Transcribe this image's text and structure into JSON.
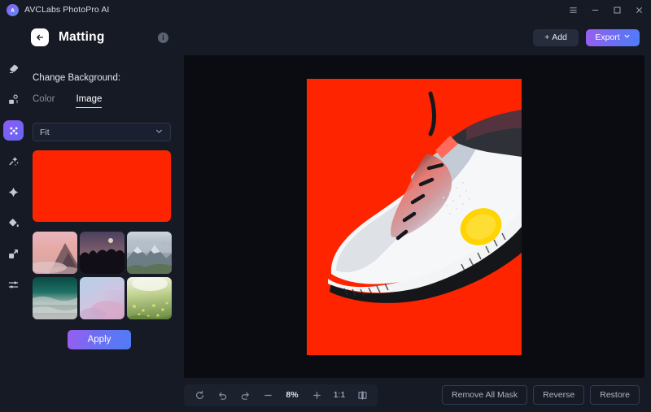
{
  "titlebar": {
    "app_name": "AVCLabs PhotoPro AI",
    "logo_icon": "ai-logo-icon",
    "controls": [
      {
        "name": "menu-icon",
        "label": "Menu"
      },
      {
        "name": "minimize-icon",
        "label": "Minimize"
      },
      {
        "name": "maximize-icon",
        "label": "Maximize"
      },
      {
        "name": "close-icon",
        "label": "Close"
      }
    ]
  },
  "rail": {
    "items": [
      {
        "name": "eraser-icon",
        "label": "Erase",
        "active": false
      },
      {
        "name": "object-remove-icon",
        "label": "Object Remove",
        "active": false
      },
      {
        "name": "matting-icon",
        "label": "Matting",
        "active": true
      },
      {
        "name": "magic-wand-icon",
        "label": "Magic Wand",
        "active": false
      },
      {
        "name": "enhance-icon",
        "label": "Enhance",
        "active": false
      },
      {
        "name": "paint-bucket-icon",
        "label": "Paint Bucket",
        "active": false
      },
      {
        "name": "resize-icon",
        "label": "Resize",
        "active": false
      },
      {
        "name": "adjust-sliders-icon",
        "label": "Adjust",
        "active": false
      }
    ]
  },
  "panel": {
    "back_icon": "back-arrow-icon",
    "title": "Matting",
    "info_icon": "info-icon",
    "section_label": "Change Background:",
    "tabs": [
      {
        "label": "Color",
        "active": false
      },
      {
        "label": "Image",
        "active": true
      }
    ],
    "fit_select": {
      "value": "Fit",
      "chevron_icon": "chevron-down-icon"
    },
    "preview_color": "#FF2400",
    "thumbnails": [
      {
        "name": "thumb-sunset-mountain",
        "alt": "Sunset mountain peak",
        "c1": "#f0bcc0",
        "c2": "#d79a9b",
        "c3": "#6f5057"
      },
      {
        "name": "thumb-night-treeline",
        "alt": "Night treeline with moon",
        "c1": "#5e4a63",
        "c2": "#8c6a73",
        "c3": "#14101a"
      },
      {
        "name": "thumb-snowy-mountains",
        "alt": "Snowy mountain range",
        "c1": "#b9c3cd",
        "c2": "#8d98a6",
        "c3": "#5b6a66"
      },
      {
        "name": "thumb-teal-ocean",
        "alt": "Teal ocean waves",
        "c1": "#0f5b52",
        "c2": "#5f8f8d",
        "c3": "#b9bcbd"
      },
      {
        "name": "thumb-pink-blue-sky",
        "alt": "Pink and blue sky",
        "c1": "#b8cfe4",
        "c2": "#d9bdd9",
        "c3": "#c9a7c4"
      },
      {
        "name": "thumb-green-meadow",
        "alt": "Green meadow flowers",
        "c1": "#e9eddc",
        "c2": "#a8bf77",
        "c3": "#6e8d4a"
      }
    ],
    "apply_label": "Apply"
  },
  "main": {
    "add_button": {
      "label": "Add",
      "icon": "plus-icon"
    },
    "export_button": {
      "label": "Export",
      "icon": "chevron-down-icon"
    },
    "canvas": {
      "background_color": "#0A0C11",
      "artboard_background": "#FF2400",
      "subject": "white-sneaker-photo"
    }
  },
  "bottombar": {
    "zoom_controls": [
      {
        "name": "reset-icon",
        "label": "Reset"
      },
      {
        "name": "undo-icon",
        "label": "Undo"
      },
      {
        "name": "redo-icon",
        "label": "Redo"
      },
      {
        "name": "zoom-out-icon",
        "label": "Zoom out"
      }
    ],
    "zoom_value": "8%",
    "zoom_in_icon": "zoom-in-icon",
    "ratio_label": "1:1",
    "compare_icon": "split-compare-icon",
    "actions": [
      {
        "name": "remove-all-mask-button",
        "label": "Remove All Mask"
      },
      {
        "name": "reverse-button",
        "label": "Reverse"
      },
      {
        "name": "restore-button",
        "label": "Restore"
      }
    ]
  },
  "colors": {
    "accent_start": "#9B5DF0",
    "accent_end": "#4F7CF7",
    "app_bg": "#161A24",
    "canvas_bg": "#0A0C11",
    "artboard_red": "#FF2400"
  }
}
